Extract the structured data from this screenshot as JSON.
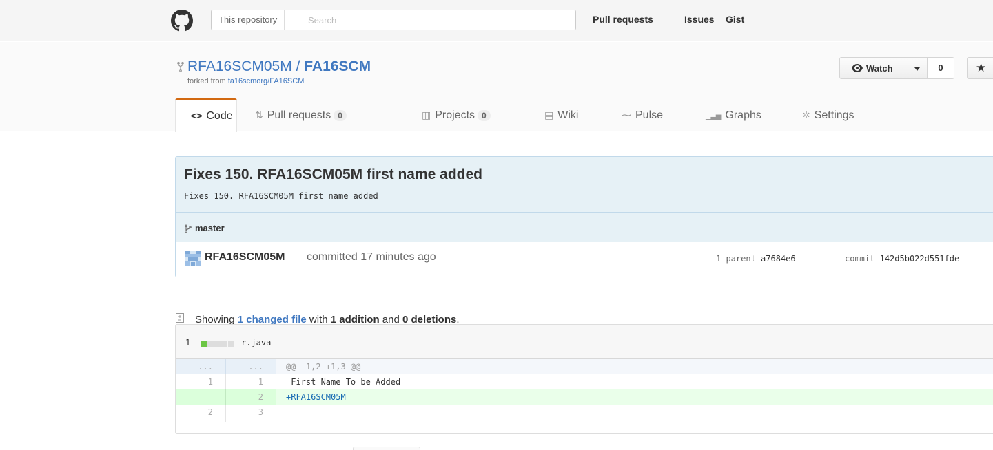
{
  "header": {
    "scope_label": "This repository",
    "search_placeholder": "Search",
    "nav": [
      "Pull requests",
      "Issues",
      "Gist"
    ]
  },
  "repo": {
    "owner": "RFA16SCM05M",
    "separator": "/",
    "name": "FA16SCM",
    "forked_prefix": "forked from",
    "forked_from": "fa16scmorg/FA16SCM",
    "watch_label": "Watch",
    "watch_count": "0",
    "star_icon": "★"
  },
  "tabs": [
    {
      "icon": "<>",
      "label": "Code",
      "counter": ""
    },
    {
      "icon": "⇅",
      "label": "Pull requests",
      "counter": "0"
    },
    {
      "icon": "▥",
      "label": "Projects",
      "counter": "0"
    },
    {
      "icon": "▤",
      "label": "Wiki",
      "counter": ""
    },
    {
      "icon": "⁓",
      "label": "Pulse",
      "counter": ""
    },
    {
      "icon": "▁▃▅",
      "label": "Graphs",
      "counter": ""
    },
    {
      "icon": "✲",
      "label": "Settings",
      "counter": ""
    }
  ],
  "commit": {
    "title": "Fixes 150. RFA16SCM05M first name added",
    "description": "Fixes 150. RFA16SCM05M first name added",
    "branch": "master",
    "author": "RFA16SCM05M",
    "committed_text": "committed 17 minutes ago",
    "parent_label": "1 parent",
    "parent_sha": "a7684e6",
    "commit_label": "commit",
    "commit_sha": "142d5b022d551fde"
  },
  "summary": {
    "showing": "Showing",
    "changed": "1 changed file",
    "with": "with",
    "additions": "1 addition",
    "and": "and",
    "deletions": "0 deletions",
    "period": "."
  },
  "file": {
    "count": "1",
    "name": "r.java",
    "diffstat_added_blocks": 1,
    "diffstat_total_blocks": 5,
    "lines": [
      {
        "type": "hunk",
        "old": "...",
        "new": "...",
        "code": "@@ -1,2 +1,3 @@"
      },
      {
        "type": "context",
        "old": "1",
        "new": "1",
        "code": " First Name To be Added"
      },
      {
        "type": "add",
        "old": "",
        "new": "2",
        "code": "+RFA16SCM05M"
      },
      {
        "type": "context",
        "old": "2",
        "new": "3",
        "code": ""
      }
    ]
  },
  "colors": {
    "accent": "#4078c0",
    "tab_selected_border": "#d26911",
    "commit_bg": "#e6f1f6",
    "added_line_bg": "#eaffea",
    "diffstat_add": "#6cc644"
  }
}
